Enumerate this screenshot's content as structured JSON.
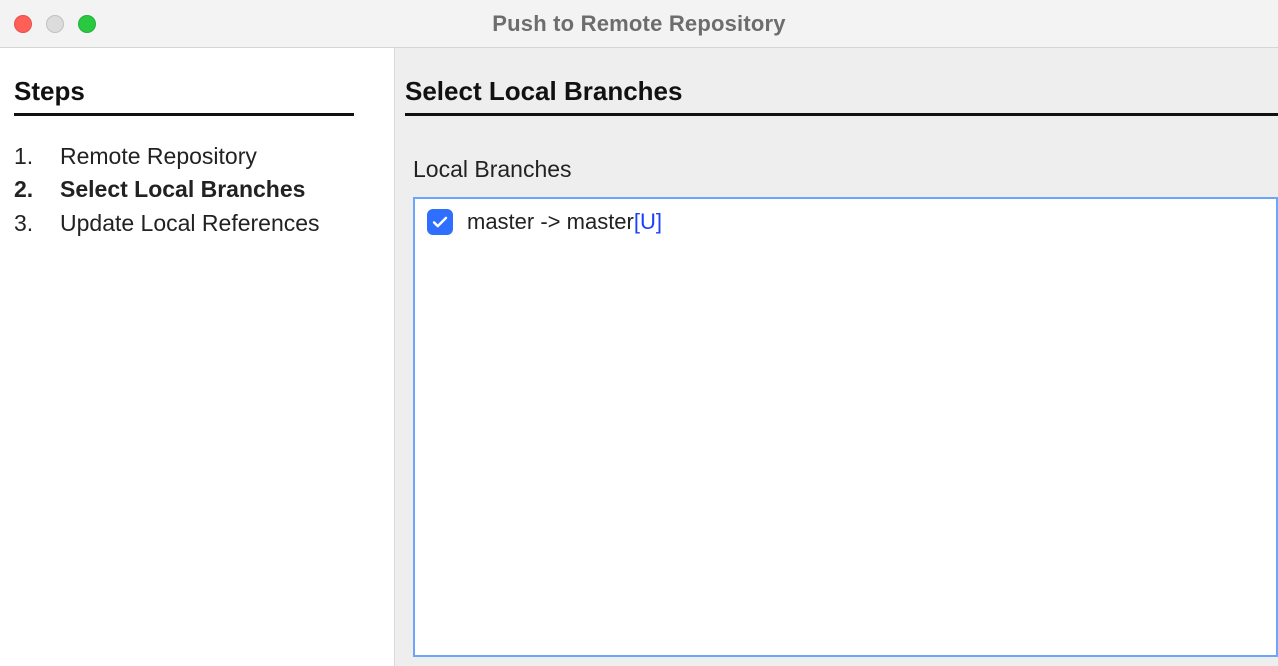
{
  "window": {
    "title": "Push to Remote Repository"
  },
  "sidebar": {
    "heading": "Steps",
    "steps": [
      {
        "num": "1.",
        "label": "Remote Repository",
        "current": false
      },
      {
        "num": "2.",
        "label": "Select Local Branches",
        "current": true
      },
      {
        "num": "3.",
        "label": "Update Local References",
        "current": false
      }
    ]
  },
  "main": {
    "heading": "Select Local Branches",
    "section_label": "Local Branches",
    "branches": [
      {
        "checked": true,
        "text": "master -> master ",
        "flag": "[U]"
      }
    ]
  }
}
